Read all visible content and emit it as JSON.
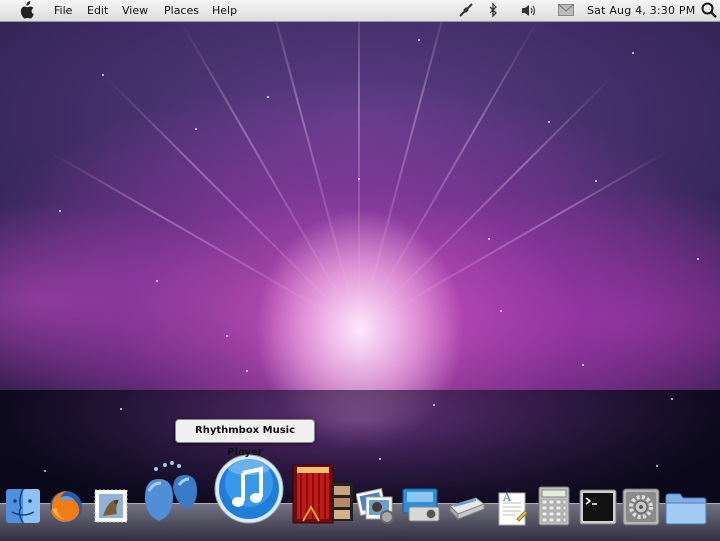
{
  "menubar": {
    "menus": [
      "File",
      "Edit",
      "View",
      "Places",
      "Help"
    ],
    "clock": "Sat Aug  4,  3:30 PM",
    "icons": [
      "apple-icon",
      "network-icon",
      "bluetooth-icon",
      "volume-icon",
      "mail-icon",
      "spotlight-search-icon"
    ]
  },
  "dock": {
    "tooltip": "Rhythmbox Music Player",
    "apps": [
      "finder-icon",
      "firefox-icon",
      "mail-stamp-icon",
      "pidgin-icon",
      "rhythmbox-icon",
      "video-player-icon",
      "photo-viewer-icon",
      "camera-icon",
      "scanner-icon",
      "text-editor-icon",
      "calculator-icon",
      "terminal-icon",
      "system-preferences-icon",
      "folder-icon"
    ]
  },
  "colors": {
    "wallpaper_accent": "#e05ad2",
    "rhythmbox_blue": "#1e7fd8",
    "menubar_bg": "#e8e8e8"
  }
}
